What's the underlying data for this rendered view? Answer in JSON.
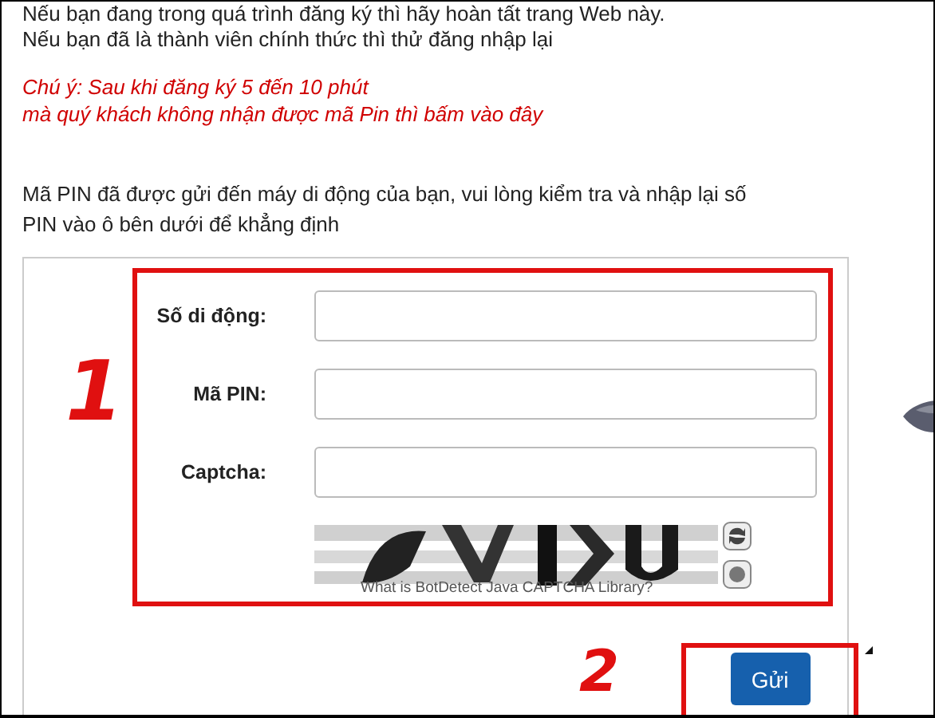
{
  "intro_lines": [
    "Nếu bạn đang trong quá trình đăng ký thì hãy hoàn tất trang Web này.",
    "Nếu bạn đã là thành viên chính thức thì thử đăng nhập lại"
  ],
  "notice_lines": [
    "Chú ý: Sau khi đăng ký 5 đến 10 phút",
    "mà quý khách không nhận được mã Pin thì bấm vào đây"
  ],
  "instruction": "Mã PIN đã được gửi đến máy di động của bạn, vui lòng kiểm tra và nhập lại số PIN vào ô bên dưới để khẳng định",
  "form": {
    "fields": [
      {
        "label": "Số di động:"
      },
      {
        "label": "Mã PIN:"
      },
      {
        "label": "Captcha:"
      }
    ],
    "captcha_link": "What is BotDetect Java CAPTCHA Library?",
    "submit_button": "Gửi"
  },
  "annotations": [
    {
      "label": "1"
    },
    {
      "label": "2"
    }
  ]
}
